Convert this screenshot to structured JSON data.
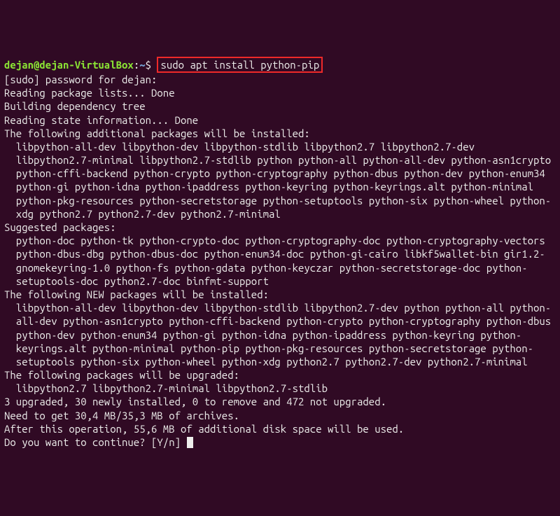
{
  "prompt": {
    "user_host": "dejan@dejan-VirtualBox",
    "separator": ":",
    "path": "~",
    "dollar": "$ "
  },
  "command": "sudo apt install python-pip",
  "output": {
    "sudo_pw": "[sudo] password for dejan:",
    "reading_lists": "Reading package lists... Done",
    "building_tree": "Building dependency tree",
    "reading_state": "Reading state information... Done",
    "additional_header": "The following additional packages will be installed:",
    "additional_pkgs": "libpython-all-dev libpython-dev libpython-stdlib libpython2.7 libpython2.7-dev libpython2.7-minimal libpython2.7-stdlib python python-all python-all-dev python-asn1crypto python-cffi-backend python-crypto python-cryptography python-dbus python-dev python-enum34 python-gi python-idna python-ipaddress python-keyring python-keyrings.alt python-minimal python-pkg-resources python-secretstorage python-setuptools python-six python-wheel python-xdg python2.7 python2.7-dev python2.7-minimal",
    "suggested_header": "Suggested packages:",
    "suggested_pkgs": "python-doc python-tk python-crypto-doc python-cryptography-doc python-cryptography-vectors python-dbus-dbg python-dbus-doc python-enum34-doc python-gi-cairo libkf5wallet-bin gir1.2-gnomekeyring-1.0 python-fs python-gdata python-keyczar python-secretstorage-doc python-setuptools-doc python2.7-doc binfmt-support",
    "new_header": "The following NEW packages will be installed:",
    "new_pkgs": "libpython-all-dev libpython-dev libpython-stdlib libpython2.7-dev python python-all python-all-dev python-asn1crypto python-cffi-backend python-crypto python-cryptography python-dbus python-dev python-enum34 python-gi python-idna python-ipaddress python-keyring python-keyrings.alt python-minimal python-pip python-pkg-resources python-secretstorage python-setuptools python-six python-wheel python-xdg python2.7 python2.7-dev python2.7-minimal",
    "upgrade_header": "The following packages will be upgraded:",
    "upgrade_pkgs": "libpython2.7 libpython2.7-minimal libpython2.7-stdlib",
    "summary": "3 upgraded, 30 newly installed, 0 to remove and 472 not upgraded.",
    "need_get": "Need to get 30,4 MB/35,3 MB of archives.",
    "after_op": "After this operation, 55,6 MB of additional disk space will be used.",
    "continue_prompt": "Do you want to continue? [Y/n] "
  }
}
